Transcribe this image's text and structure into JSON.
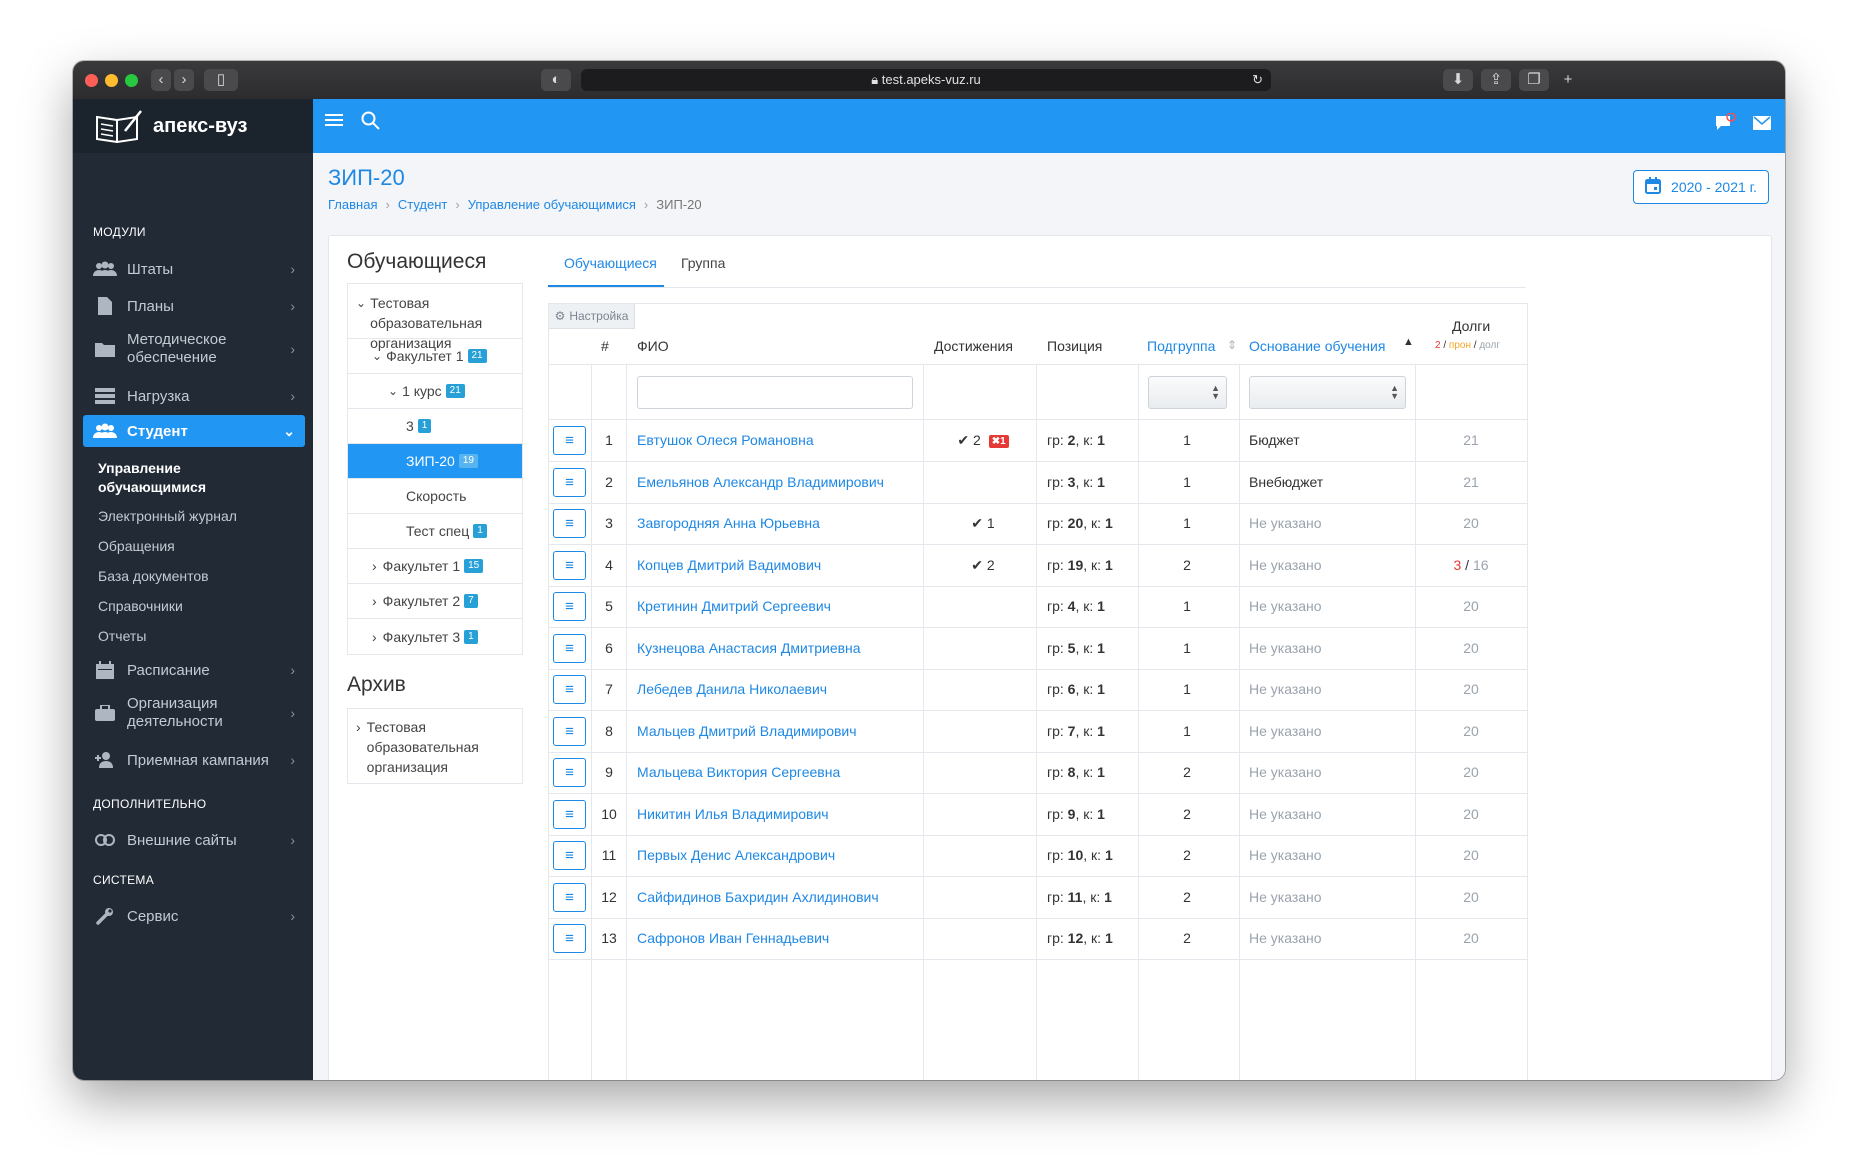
{
  "browser": {
    "url": "test.apeks-vuz.ru"
  },
  "brand": {
    "name": "апекс-вуз"
  },
  "sidebar": {
    "sections": {
      "modules": "МОДУЛИ",
      "extra": "ДОПОЛНИТЕЛЬНО",
      "system": "СИСТЕМА"
    },
    "items": [
      {
        "label": "Штаты",
        "icon": "users-icon"
      },
      {
        "label": "Планы",
        "icon": "document-icon"
      },
      {
        "label": "Методическое обеспечение",
        "icon": "folder-icon"
      },
      {
        "label": "Нагрузка",
        "icon": "server-icon"
      },
      {
        "label": "Студент",
        "icon": "users-icon"
      },
      {
        "label": "Расписание",
        "icon": "calendar-icon"
      },
      {
        "label": "Организация деятельности",
        "icon": "briefcase-icon"
      },
      {
        "label": "Приемная кампания",
        "icon": "user-plus-icon"
      },
      {
        "label": "Внешние сайты",
        "icon": "link-icon"
      },
      {
        "label": "Сервис",
        "icon": "wrench-icon"
      }
    ],
    "student_sub": [
      "Управление обучающимися",
      "Электронный журнал",
      "Обращения",
      "База документов",
      "Справочники",
      "Отчеты"
    ]
  },
  "page": {
    "title": "ЗИП-20",
    "breadcrumbs": [
      "Главная",
      "Студент",
      "Управление обучающимися",
      "ЗИП-20"
    ],
    "year": "2020 - 2021 г."
  },
  "tree": {
    "title": "Обучающиеся",
    "rows": [
      {
        "label": "Тестовая образовательная организация",
        "badge": ""
      },
      {
        "label": "Факультет 1",
        "badge": "21"
      },
      {
        "label": "1 курс",
        "badge": "21"
      },
      {
        "label": "3",
        "badge": "1"
      },
      {
        "label": "ЗИП-20",
        "badge": "19"
      },
      {
        "label": "Скорость",
        "badge": ""
      },
      {
        "label": "Тест спец",
        "badge": "1"
      },
      {
        "label": "Факультет 1",
        "badge": "15"
      },
      {
        "label": "Факультет 2",
        "badge": "7"
      },
      {
        "label": "Факультет 3",
        "badge": "1"
      }
    ],
    "archive_title": "Архив",
    "archive_row": "Тестовая образовательная организация"
  },
  "tabs": [
    "Обучающиеся",
    "Группа"
  ],
  "table": {
    "settings_label": "Настройка",
    "headers": {
      "num": "#",
      "name": "ФИО",
      "achievements": "Достижения",
      "position": "Позиция",
      "subgroup": "Подгруппа",
      "basis": "Основание обучения",
      "debts": "Долги",
      "debts_sub": [
        "2",
        "прон",
        "долг"
      ]
    },
    "rows": [
      {
        "n": "1",
        "name": "Евтушок Олеся Романовна",
        "ach": "2",
        "ach_x": "1",
        "gr": "2",
        "k": "1",
        "sub": "1",
        "basis": "Бюджет",
        "basis_set": true,
        "debt_red": "",
        "debt": "21"
      },
      {
        "n": "2",
        "name": "Емельянов Александр Владимирович",
        "ach": "",
        "ach_x": "",
        "gr": "3",
        "k": "1",
        "sub": "1",
        "basis": "Внебюджет",
        "basis_set": true,
        "debt_red": "",
        "debt": "21"
      },
      {
        "n": "3",
        "name": "Завгородняя Анна Юрьевна",
        "ach": "1",
        "ach_x": "",
        "gr": "20",
        "k": "1",
        "sub": "1",
        "basis": "Не указано",
        "basis_set": false,
        "debt_red": "",
        "debt": "20"
      },
      {
        "n": "4",
        "name": "Копцев Дмитрий Вадимович",
        "ach": "2",
        "ach_x": "",
        "gr": "19",
        "k": "1",
        "sub": "2",
        "basis": "Не указано",
        "basis_set": false,
        "debt_red": "3",
        "debt": "16"
      },
      {
        "n": "5",
        "name": "Кретинин Дмитрий Сергеевич",
        "ach": "",
        "ach_x": "",
        "gr": "4",
        "k": "1",
        "sub": "1",
        "basis": "Не указано",
        "basis_set": false,
        "debt_red": "",
        "debt": "20"
      },
      {
        "n": "6",
        "name": "Кузнецова Анастасия Дмитриевна",
        "ach": "",
        "ach_x": "",
        "gr": "5",
        "k": "1",
        "sub": "1",
        "basis": "Не указано",
        "basis_set": false,
        "debt_red": "",
        "debt": "20"
      },
      {
        "n": "7",
        "name": "Лебедев Данила Николаевич",
        "ach": "",
        "ach_x": "",
        "gr": "6",
        "k": "1",
        "sub": "1",
        "basis": "Не указано",
        "basis_set": false,
        "debt_red": "",
        "debt": "20"
      },
      {
        "n": "8",
        "name": "Мальцев Дмитрий Владимирович",
        "ach": "",
        "ach_x": "",
        "gr": "7",
        "k": "1",
        "sub": "1",
        "basis": "Не указано",
        "basis_set": false,
        "debt_red": "",
        "debt": "20"
      },
      {
        "n": "9",
        "name": "Мальцева Виктория Сергеевна",
        "ach": "",
        "ach_x": "",
        "gr": "8",
        "k": "1",
        "sub": "2",
        "basis": "Не указано",
        "basis_set": false,
        "debt_red": "",
        "debt": "20"
      },
      {
        "n": "10",
        "name": "Никитин Илья Владимирович",
        "ach": "",
        "ach_x": "",
        "gr": "9",
        "k": "1",
        "sub": "2",
        "basis": "Не указано",
        "basis_set": false,
        "debt_red": "",
        "debt": "20"
      },
      {
        "n": "11",
        "name": "Первых Денис Александрович",
        "ach": "",
        "ach_x": "",
        "gr": "10",
        "k": "1",
        "sub": "2",
        "basis": "Не указано",
        "basis_set": false,
        "debt_red": "",
        "debt": "20"
      },
      {
        "n": "12",
        "name": "Сайфидинов Бахридин Ахлидинович",
        "ach": "",
        "ach_x": "",
        "gr": "11",
        "k": "1",
        "sub": "2",
        "basis": "Не указано",
        "basis_set": false,
        "debt_red": "",
        "debt": "20"
      },
      {
        "n": "13",
        "name": "Сафронов Иван Геннадьевич",
        "ach": "",
        "ach_x": "",
        "gr": "12",
        "k": "1",
        "sub": "2",
        "basis": "Не указано",
        "basis_set": false,
        "debt_red": "",
        "debt": "20"
      }
    ]
  },
  "colors": {
    "accent": "#2196f3",
    "sidebar": "#212a35",
    "debt_red": "#e53935",
    "debt_orange": "#f5a623"
  }
}
